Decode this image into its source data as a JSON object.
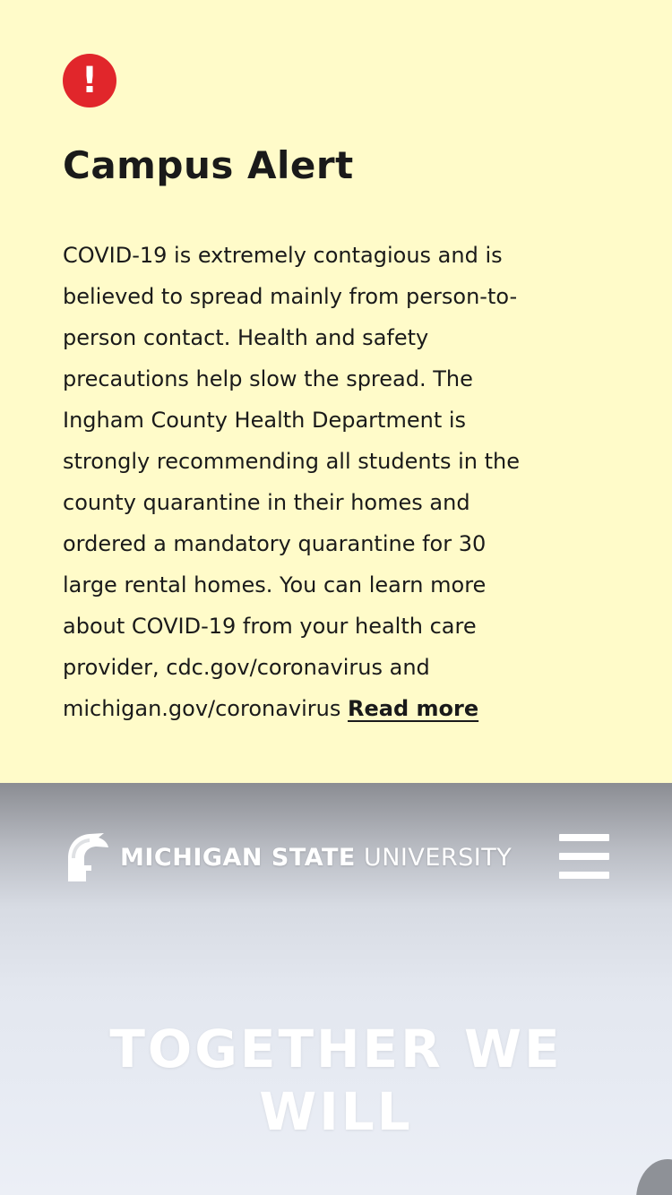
{
  "alert": {
    "icon": "exclamation-icon",
    "icon_glyph": "!",
    "icon_color": "#e1262b",
    "background_color": "#fffbc9",
    "title": "Campus Alert",
    "body_lines": [
      "COVID-19 is extremely contagious and is",
      "believed to spread mainly from person-to-",
      "person contact. Health and safety",
      "precautions help slow the spread. The",
      "Ingham County Health Department is",
      "strongly recommending all students in the",
      "county quarantine in their homes and",
      "ordered a mandatory quarantine for 30",
      "large rental homes. You can learn more",
      "about COVID-19 from your health care",
      "provider, cdc.gov/coronavirus and",
      "michigan.gov/coronavirus"
    ],
    "read_more": "Read more"
  },
  "header": {
    "logo_icon": "spartan-helmet-icon",
    "wordmark_bold": "MICHIGAN STATE",
    "wordmark_light": "UNIVERSITY",
    "menu_icon": "hamburger-menu-icon"
  },
  "hero": {
    "title_line1": "TOGETHER WE",
    "title_line2": "WILL"
  }
}
